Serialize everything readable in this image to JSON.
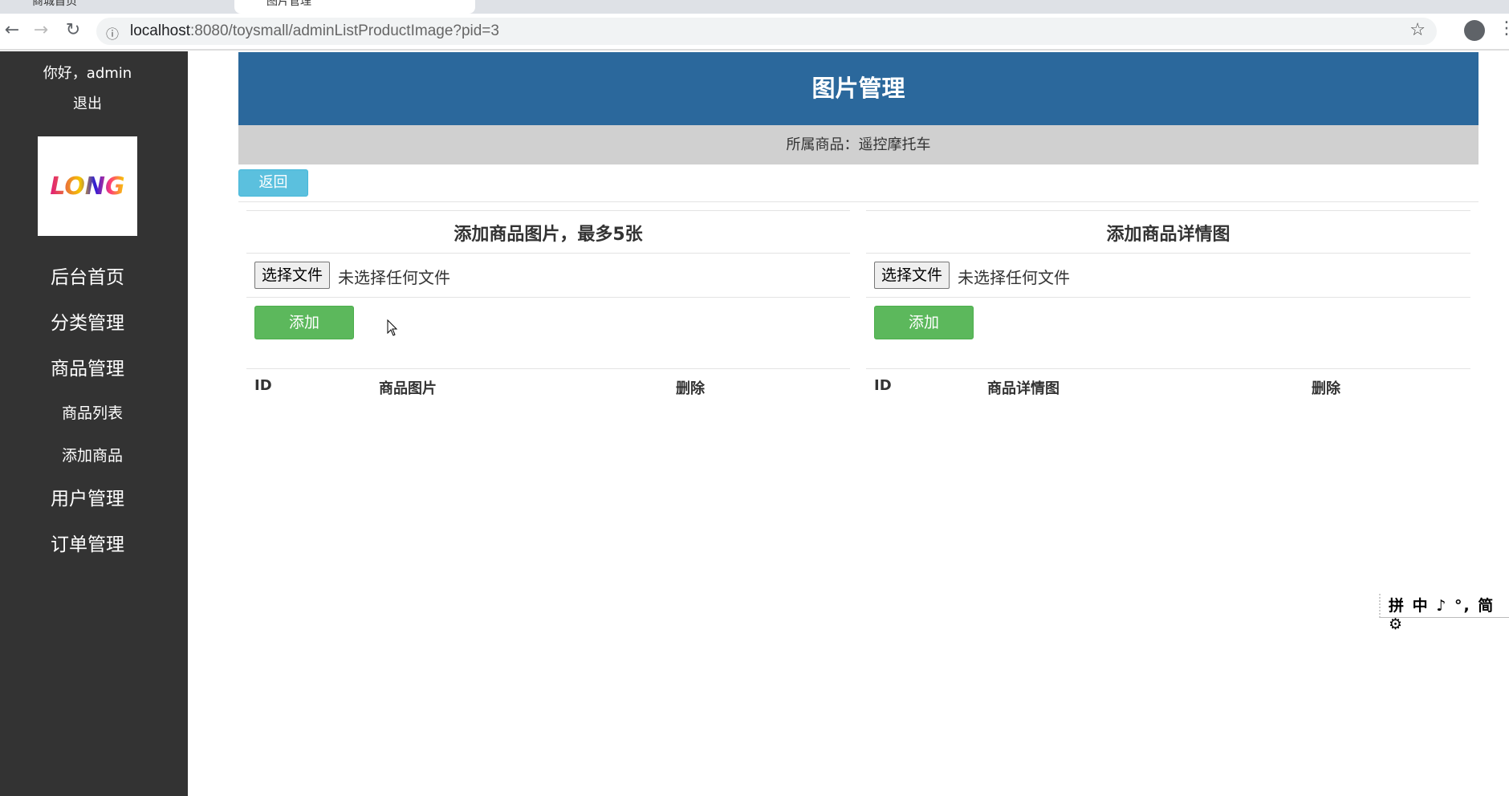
{
  "browser": {
    "tabs": [
      {
        "label": "商城首页"
      },
      {
        "label": "图片管理"
      }
    ],
    "url_host": "localhost",
    "url_rest": ":8080/toysmall/adminListProductImage?pid=3"
  },
  "sidebar": {
    "greeting": "你好，admin",
    "logout": "退出",
    "logo_text": "LONG",
    "items": [
      {
        "label": "后台首页"
      },
      {
        "label": "分类管理"
      },
      {
        "label": "商品管理"
      },
      {
        "label": "商品列表"
      },
      {
        "label": "添加商品"
      },
      {
        "label": "用户管理"
      },
      {
        "label": "订单管理"
      }
    ]
  },
  "main": {
    "title": "图片管理",
    "product_line": "所属商品：遥控摩托车",
    "back": "返回",
    "left": {
      "title": "添加商品图片，最多5张",
      "file_button": "选择文件",
      "file_status": "未选择任何文件",
      "add": "添加",
      "columns": [
        "ID",
        "商品图片",
        "删除"
      ]
    },
    "right": {
      "title": "添加商品详情图",
      "file_button": "选择文件",
      "file_status": "未选择任何文件",
      "add": "添加",
      "columns": [
        "ID",
        "商品详情图",
        "删除"
      ]
    }
  },
  "ime": {
    "text": "拼 中 ♪ °, 简 ⚙"
  }
}
